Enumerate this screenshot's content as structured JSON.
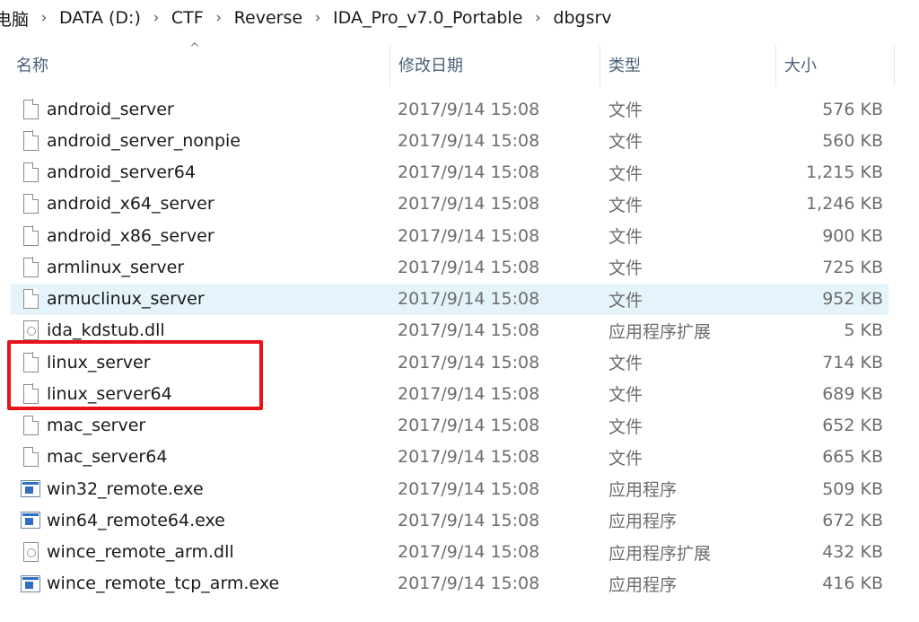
{
  "breadcrumb": [
    {
      "label": "电脑"
    },
    {
      "label": "DATA (D:)"
    },
    {
      "label": "CTF"
    },
    {
      "label": "Reverse"
    },
    {
      "label": "IDA_Pro_v7.0_Portable"
    },
    {
      "label": "dbgsrv"
    }
  ],
  "breadcrumb_separator": "›",
  "columns": {
    "name": "名称",
    "date": "修改日期",
    "type": "类型",
    "size": "大小",
    "sort_indicator": "^"
  },
  "files": [
    {
      "name": "android_server",
      "date": "2017/9/14 15:08",
      "type": "文件",
      "size": "576 KB",
      "icon": "file-icon"
    },
    {
      "name": "android_server_nonpie",
      "date": "2017/9/14 15:08",
      "type": "文件",
      "size": "560 KB",
      "icon": "file-icon"
    },
    {
      "name": "android_server64",
      "date": "2017/9/14 15:08",
      "type": "文件",
      "size": "1,215 KB",
      "icon": "file-icon"
    },
    {
      "name": "android_x64_server",
      "date": "2017/9/14 15:08",
      "type": "文件",
      "size": "1,246 KB",
      "icon": "file-icon"
    },
    {
      "name": "android_x86_server",
      "date": "2017/9/14 15:08",
      "type": "文件",
      "size": "900 KB",
      "icon": "file-icon"
    },
    {
      "name": "armlinux_server",
      "date": "2017/9/14 15:08",
      "type": "文件",
      "size": "725 KB",
      "icon": "file-icon"
    },
    {
      "name": "armuclinux_server",
      "date": "2017/9/14 15:08",
      "type": "文件",
      "size": "952 KB",
      "icon": "file-icon"
    },
    {
      "name": "ida_kdstub.dll",
      "date": "2017/9/14 15:08",
      "type": "应用程序扩展",
      "size": "5 KB",
      "icon": "dll-icon"
    },
    {
      "name": "linux_server",
      "date": "2017/9/14 15:08",
      "type": "文件",
      "size": "714 KB",
      "icon": "file-icon"
    },
    {
      "name": "linux_server64",
      "date": "2017/9/14 15:08",
      "type": "文件",
      "size": "689 KB",
      "icon": "file-icon"
    },
    {
      "name": "mac_server",
      "date": "2017/9/14 15:08",
      "type": "文件",
      "size": "652 KB",
      "icon": "file-icon"
    },
    {
      "name": "mac_server64",
      "date": "2017/9/14 15:08",
      "type": "文件",
      "size": "665 KB",
      "icon": "file-icon"
    },
    {
      "name": "win32_remote.exe",
      "date": "2017/9/14 15:08",
      "type": "应用程序",
      "size": "509 KB",
      "icon": "exe-icon"
    },
    {
      "name": "win64_remote64.exe",
      "date": "2017/9/14 15:08",
      "type": "应用程序",
      "size": "672 KB",
      "icon": "exe-icon"
    },
    {
      "name": "wince_remote_arm.dll",
      "date": "2017/9/14 15:08",
      "type": "应用程序扩展",
      "size": "432 KB",
      "icon": "dll-icon"
    },
    {
      "name": "wince_remote_tcp_arm.exe",
      "date": "2017/9/14 15:08",
      "type": "应用程序",
      "size": "416 KB",
      "icon": "exe-icon"
    }
  ],
  "hovered_file": "armuclinux_server",
  "highlighted_files": [
    "linux_server",
    "linux_server64"
  ],
  "colors": {
    "hover_background": "#e5f3fb",
    "highlight_border": "#e8131a",
    "header_text": "#4c607a"
  }
}
